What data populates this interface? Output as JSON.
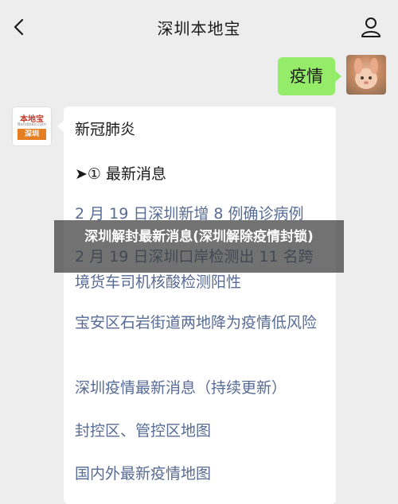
{
  "header": {
    "title": "深圳本地宝"
  },
  "outgoing": {
    "message": "疫情"
  },
  "bot_avatar": {
    "logo_top": "本地宝",
    "logo_site": "Bendibao.com",
    "logo_bottom": "深圳"
  },
  "incoming": {
    "title": "新冠肺炎",
    "section": "➤① 最新消息",
    "links": [
      "2 月 19 日深圳新增 8 例确诊病例",
      "2 月 19 日深圳口岸检测出 11 名跨境货车司机核酸检测阳性",
      "宝安区石岩街道两地降为疫情低风险",
      "深圳疫情最新消息（持续更新）",
      "封控区、管控区地图",
      "国内外最新疫情地图"
    ]
  },
  "overlay": {
    "text": "深圳解封最新消息(深圳解除疫情封锁)"
  }
}
